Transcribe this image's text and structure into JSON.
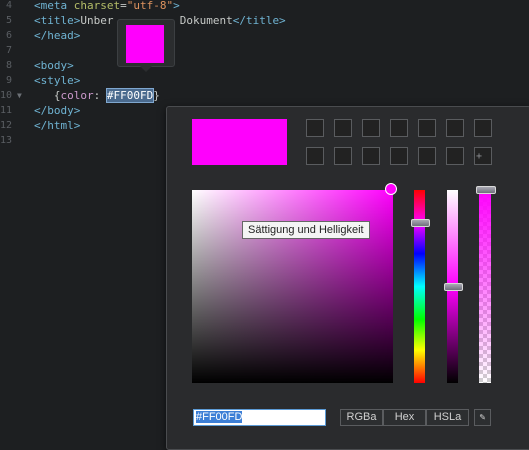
{
  "editor": {
    "lines": [
      {
        "num": "4",
        "fold": "",
        "segments": [
          {
            "t": "<meta ",
            "c": "tag"
          },
          {
            "t": "charset",
            "c": "attr"
          },
          {
            "t": "=",
            "c": "txt"
          },
          {
            "t": "\"utf-8\"",
            "c": "str"
          },
          {
            "t": ">",
            "c": "tag"
          }
        ]
      },
      {
        "num": "5",
        "fold": "",
        "segments": [
          {
            "t": "<title>",
            "c": "tag"
          },
          {
            "t": "Unber",
            "c": "txt"
          },
          {
            "t": "          ",
            "c": "txt"
          },
          {
            "t": "Dokument",
            "c": "txt"
          },
          {
            "t": "</title>",
            "c": "tag"
          }
        ]
      },
      {
        "num": "6",
        "fold": "",
        "segments": [
          {
            "t": "</head>",
            "c": "tag"
          }
        ]
      },
      {
        "num": "7",
        "fold": "",
        "segments": []
      },
      {
        "num": "8",
        "fold": "",
        "segments": [
          {
            "t": "<body>",
            "c": "tag"
          }
        ]
      },
      {
        "num": "9",
        "fold": "",
        "segments": [
          {
            "t": "<style>",
            "c": "tag"
          }
        ]
      },
      {
        "num": "10",
        "fold": "▼",
        "segments": [
          {
            "t": "   {",
            "c": "txt"
          },
          {
            "t": "color",
            "c": "prop"
          },
          {
            "t": ": ",
            "c": "txt"
          },
          {
            "t": "#FF00FD",
            "c": "hl"
          },
          {
            "t": "}",
            "c": "txt"
          }
        ]
      },
      {
        "num": "11",
        "fold": "",
        "segments": [
          {
            "t": "</body>",
            "c": "tag"
          }
        ]
      },
      {
        "num": "12",
        "fold": "",
        "segments": [
          {
            "t": "</html>",
            "c": "tag"
          }
        ]
      },
      {
        "num": "13",
        "fold": "",
        "segments": []
      }
    ]
  },
  "picker": {
    "current_color": "#FF00FD",
    "tooltip": "Sättigung und Helligkeit",
    "hex_value": "#FF00FD",
    "modes": [
      "RGBa",
      "Hex",
      "HSLa"
    ],
    "add_preset_glyph": "+",
    "eyedropper_glyph": "✎",
    "hue_level": 0.17,
    "lightness_level": 0.5,
    "alpha_level": 1.0
  }
}
